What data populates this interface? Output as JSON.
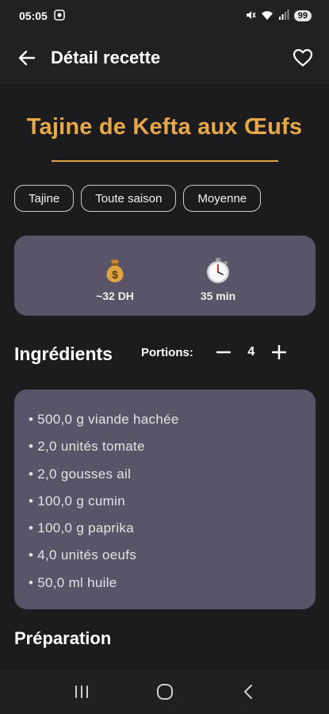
{
  "status_bar": {
    "time": "05:05",
    "battery": "99"
  },
  "app_bar": {
    "title": "Détail recette",
    "back_icon": "arrow-left-icon",
    "favorite_icon": "heart-outline-icon"
  },
  "recipe": {
    "title": "Tajine de Kefta aux Œufs",
    "tags": [
      "Tajine",
      "Toute saison",
      "Moyenne"
    ],
    "price": "~32 DH",
    "duration": "35 min",
    "price_icon": "money-bag-icon",
    "duration_icon": "stopwatch-icon"
  },
  "ingredients": {
    "title": "Ingrédients",
    "portions_label": "Portions:",
    "portions_value": "4",
    "items": [
      "• 500,0 g viande hachée",
      "• 2,0 unités tomate",
      "• 2,0 gousses ail",
      "• 100,0 g cumin",
      "• 100,0 g paprika",
      "• 4,0 unités oeufs",
      "• 50,0 ml huile"
    ]
  },
  "preparation": {
    "title": "Préparation"
  },
  "colors": {
    "accent": "#e8a84a",
    "card": "#5a5468",
    "background": "#1c1c1e"
  }
}
